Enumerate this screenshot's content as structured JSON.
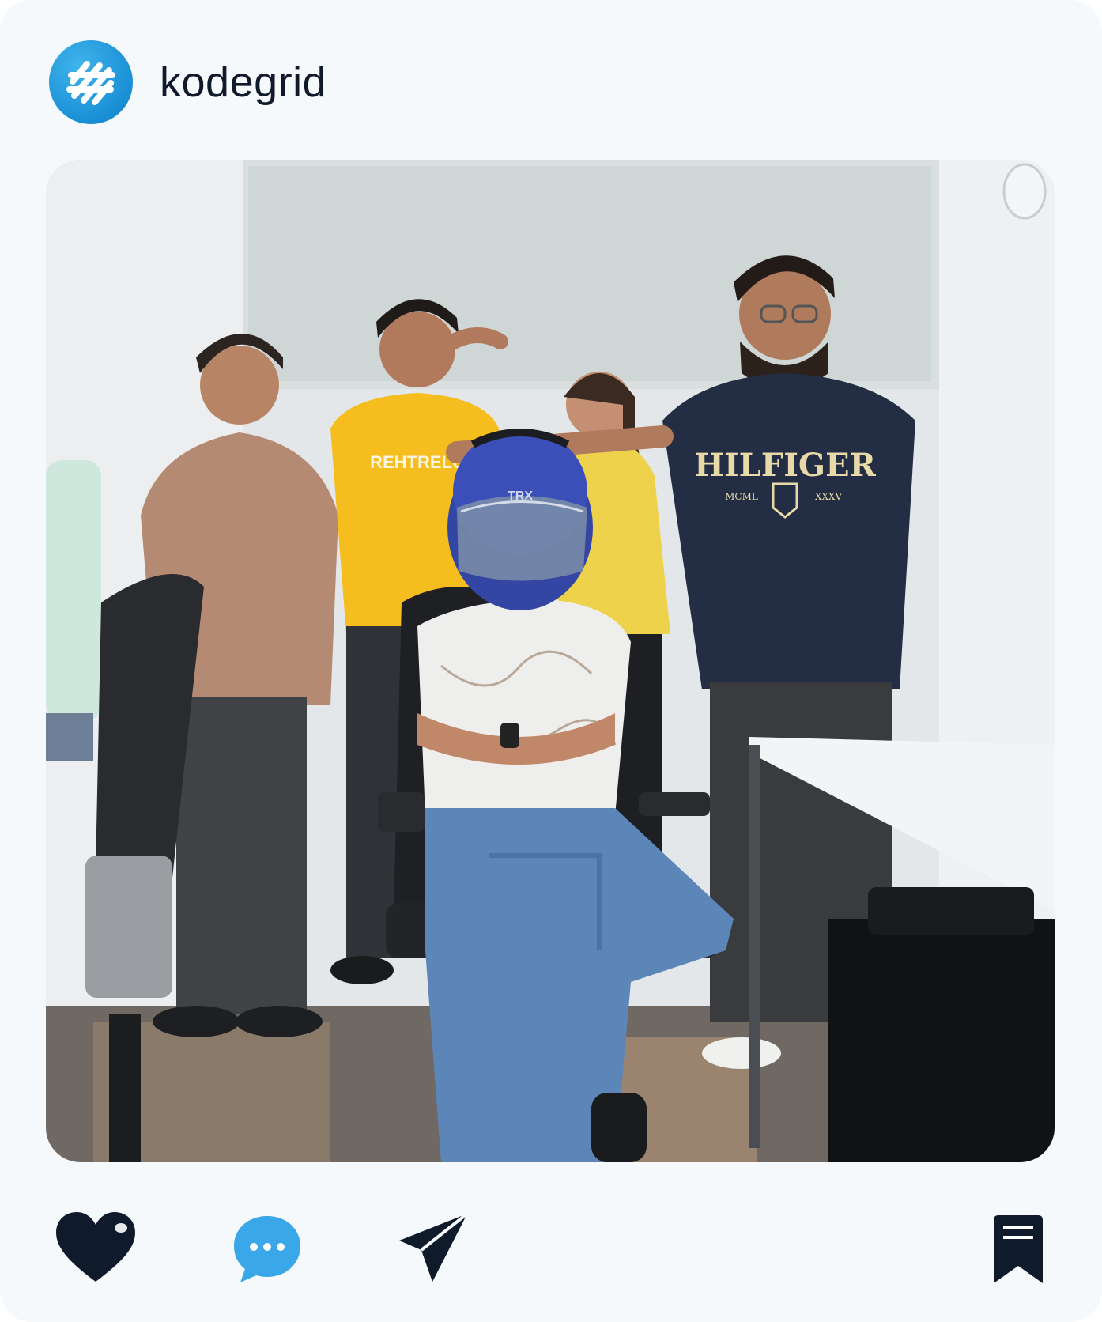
{
  "post": {
    "account_name": "kodegrid",
    "logo_icon": "kodegrid-logo-icon",
    "photo_alt": "Team photo",
    "photo_texts": {
      "shirt_main": "HILFIGER",
      "shirt_left": "MCML",
      "shirt_right": "XXXV",
      "yellow_shirt": "REHTRELU",
      "helmet_brand": "TRX"
    }
  },
  "actions": {
    "like_icon": "heart-icon",
    "comment_icon": "comment-bubble-icon",
    "share_icon": "send-icon",
    "save_icon": "bookmark-icon"
  },
  "colors": {
    "background": "#f5f9fc",
    "brand_blue": "#1a8fd6",
    "icon_dark": "#0f1a2b"
  }
}
